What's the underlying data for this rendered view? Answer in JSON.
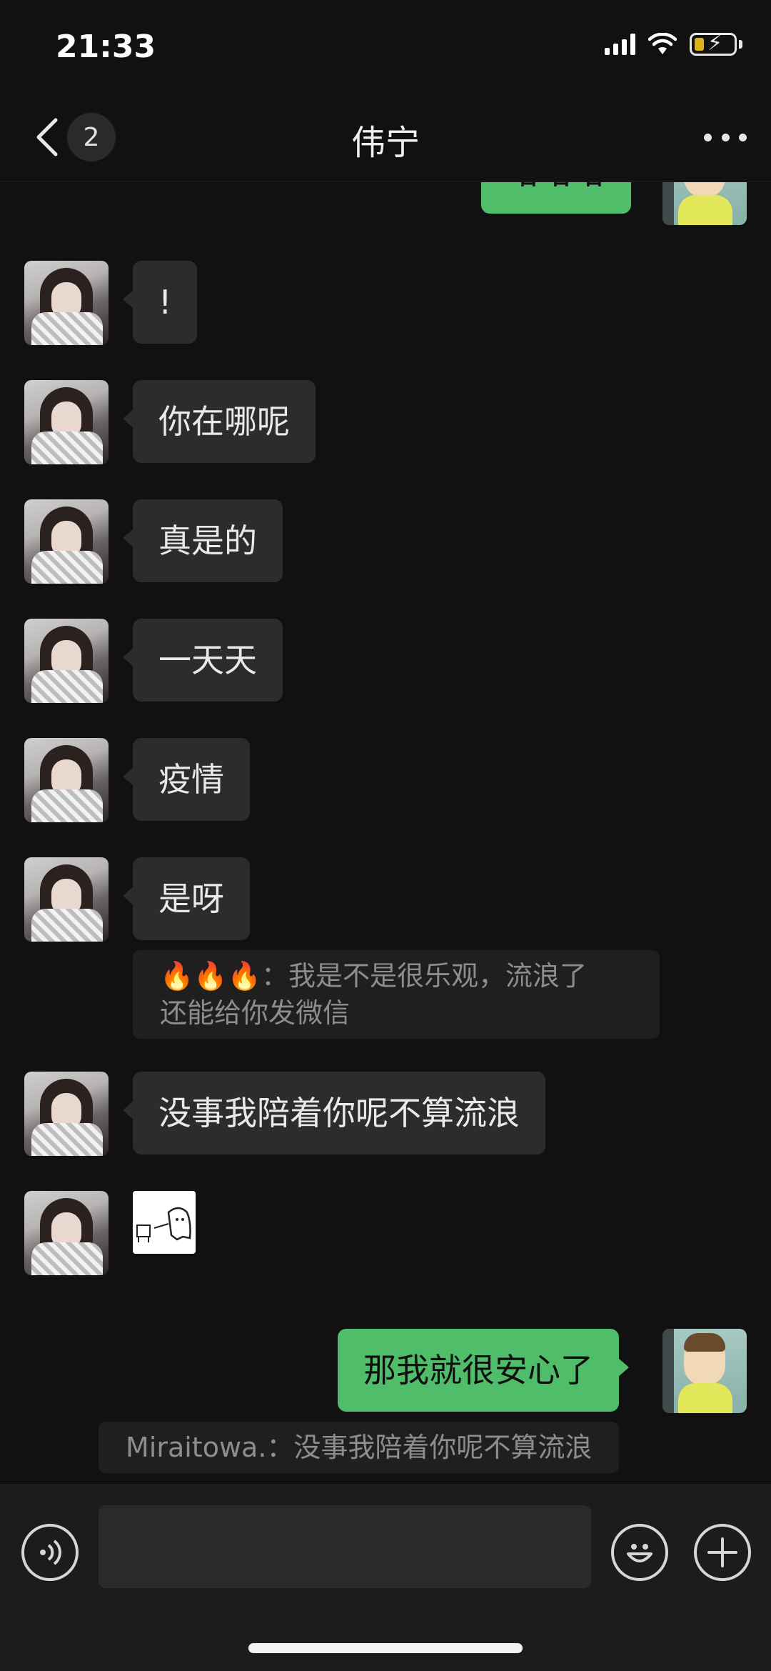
{
  "status_bar": {
    "time": "21:33"
  },
  "nav": {
    "badge_count": "2",
    "title": "伟宁"
  },
  "messages": [
    {
      "side": "right",
      "text": "哈哈哈"
    },
    {
      "side": "left",
      "text": "!"
    },
    {
      "side": "left",
      "text": "你在哪呢"
    },
    {
      "side": "left",
      "text": "真是的"
    },
    {
      "side": "left",
      "text": "一天天"
    },
    {
      "side": "left",
      "text": "疫情"
    },
    {
      "side": "left",
      "text": "是呀"
    },
    {
      "side": "left",
      "text": "没事我陪着你呢不算流浪"
    },
    {
      "side": "left",
      "text": ""
    },
    {
      "side": "right",
      "text": "那我就很安心了"
    }
  ],
  "quote_1": {
    "line1": "🔥🔥🔥：我是不是很乐观，流浪了",
    "line2": "还能给你发微信"
  },
  "quote_2": {
    "text": "Miraitowa.：没事我陪着你呢不算流浪"
  },
  "input": {
    "placeholder": ""
  },
  "colors": {
    "accent_bubble": "#4fbd69",
    "background": "#111111",
    "left_bubble": "#2c2c2c"
  }
}
